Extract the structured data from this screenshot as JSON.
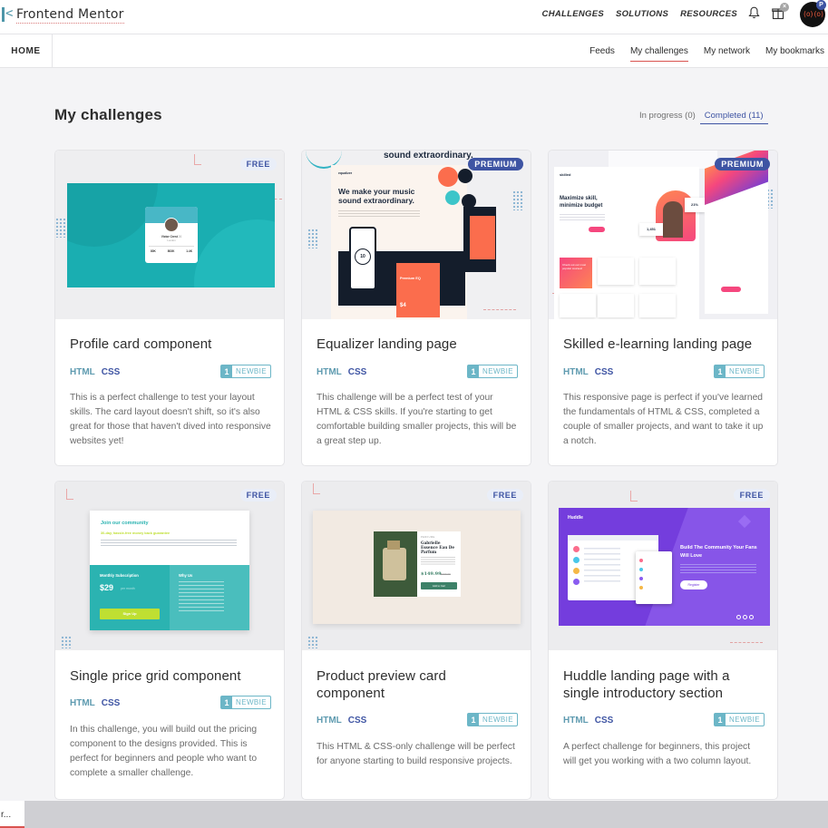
{
  "header": {
    "brand": "Frontend Mentor",
    "nav": [
      "CHALLENGES",
      "SOLUTIONS",
      "RESOURCES"
    ],
    "notifications_icon": "bell-icon",
    "gift_icon": "gift-icon",
    "avatar_initial": "P"
  },
  "subnav": {
    "home": "HOME",
    "items": [
      "Feeds",
      "My challenges",
      "My network",
      "My bookmarks"
    ],
    "active": "My challenges"
  },
  "main": {
    "title": "My challenges",
    "filters": [
      {
        "label": "In progress (0)",
        "active": false
      },
      {
        "label": "Completed (11)",
        "active": true
      }
    ]
  },
  "cards": [
    {
      "badge": "FREE",
      "title": "Profile card component",
      "tags": [
        "HTML",
        "CSS"
      ],
      "level_num": "1",
      "level_name": "NEWBIE",
      "description": "This is a perfect challenge to test your layout skills. The card layout doesn't shift, so it's also great for those that haven't dived into responsive websites yet!",
      "preview": {
        "name": "Victor Crest",
        "age": "26",
        "city": "London",
        "stats": [
          "80K",
          "803K",
          "1.4K"
        ]
      }
    },
    {
      "badge": "PREMIUM",
      "title": "Equalizer landing page",
      "tags": [
        "HTML",
        "CSS"
      ],
      "level_num": "1",
      "level_name": "NEWBIE",
      "description": "This challenge will be a perfect test of your HTML & CSS skills. If you're starting to get comfortable building smaller projects, this will be a great step up.",
      "preview": {
        "brand": "equalizer",
        "headline": "We make your music sound extraordinary.",
        "top_text": "sound extraordinary.",
        "price_label": "Premium EQ",
        "price": "$4"
      }
    },
    {
      "badge": "PREMIUM",
      "title": "Skilled e-learning landing page",
      "tags": [
        "HTML",
        "CSS"
      ],
      "level_num": "1",
      "level_name": "NEWBIE",
      "description": "This responsive page is perfect if you've learned the fundamentals of HTML & CSS, completed a couple of smaller projects, and want to take it up a notch.",
      "preview": {
        "brand": "skilled",
        "headline": "Maximize skill, minimize budget",
        "stat": "21%",
        "count": "1,451",
        "panel": "Check out our most popular courses!"
      }
    },
    {
      "badge": "FREE",
      "title": "Single price grid component",
      "tags": [
        "HTML",
        "CSS"
      ],
      "level_num": "1",
      "level_name": "NEWBIE",
      "description": "In this challenge, you will build out the pricing component to the designs provided. This is perfect for beginners and people who want to complete a smaller challenge.",
      "preview": {
        "heading": "Join our community",
        "sub": "30-day, hassle-free money back guarantee",
        "monthly": "Monthly Subscription",
        "price": "$29",
        "per": "per month",
        "cta": "Sign Up",
        "why": "Why Us"
      }
    },
    {
      "badge": "FREE",
      "title": "Product preview card component",
      "tags": [
        "HTML",
        "CSS"
      ],
      "level_num": "1",
      "level_name": "NEWBIE",
      "description": "This HTML & CSS-only challenge will be perfect for anyone starting to build responsive projects.",
      "preview": {
        "kicker": "PERFUME",
        "name": "Gabrielle Essence Eau De Parfum",
        "price": "$149.99",
        "old_price": "$169.99",
        "cta": "Add to Cart"
      }
    },
    {
      "badge": "FREE",
      "title": "Huddle landing page with a single introductory section",
      "tags": [
        "HTML",
        "CSS"
      ],
      "level_num": "1",
      "level_name": "NEWBIE",
      "description": "A perfect challenge for beginners, this project will get you working with a two column layout.",
      "preview": {
        "brand": "Huddle",
        "headline": "Build The Community Your Fans Will Love",
        "cta": "Register"
      }
    }
  ],
  "status": {
    "label": "r..."
  },
  "colors": {
    "accent": "#3e54a3",
    "html_tag": "#5f9bb0",
    "newbie": "#6cb6c7",
    "active_underline": "#d9534f"
  }
}
